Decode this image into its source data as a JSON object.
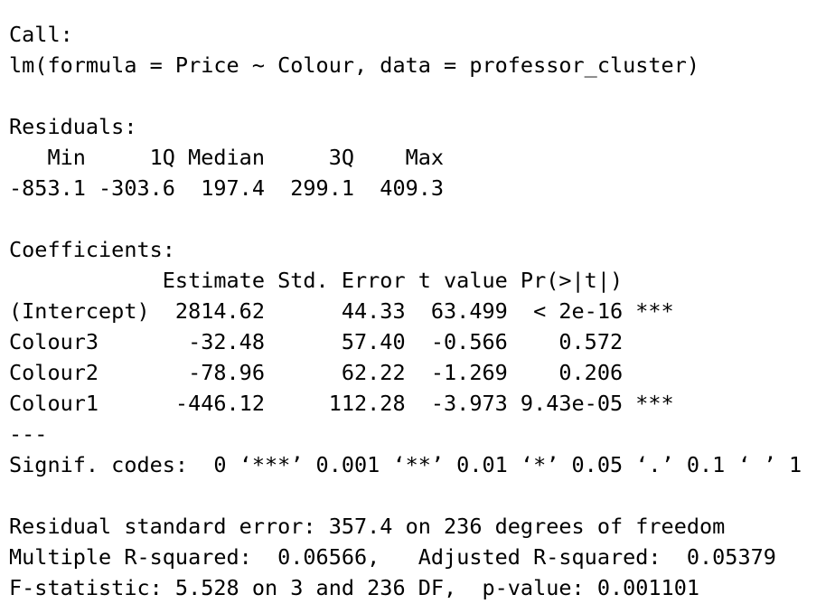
{
  "call": {
    "heading": "Call:",
    "formula": "lm(formula = Price ~ Colour, data = professor_cluster)"
  },
  "residuals": {
    "heading": "Residuals:",
    "header_row": "   Min     1Q Median     3Q    Max ",
    "value_row": "-853.1 -303.6  197.4  299.1  409.3 "
  },
  "coefficients": {
    "heading": "Coefficients:",
    "header_row": "            Estimate Std. Error t value Pr(>|t|)    ",
    "rows": [
      "(Intercept)  2814.62      44.33  63.499  < 2e-16 ***",
      "Colour3       -32.48      57.40  -0.566    0.572    ",
      "Colour2       -78.96      62.22  -1.269    0.206    ",
      "Colour1      -446.12     112.28  -3.973 9.43e-05 ***"
    ],
    "separator": "---",
    "signif_codes": "Signif. codes:  0 ‘***’ 0.001 ‘**’ 0.01 ‘*’ 0.05 ‘.’ 0.1 ‘ ’ 1"
  },
  "summary": {
    "residual_se": "Residual standard error: 357.4 on 236 degrees of freedom",
    "r_squared": "Multiple R-squared:  0.06566,\tAdjusted R-squared:  0.05379 ",
    "f_statistic": "F-statistic: 5.528 on 3 and 236 DF,  p-value: 0.001101"
  }
}
